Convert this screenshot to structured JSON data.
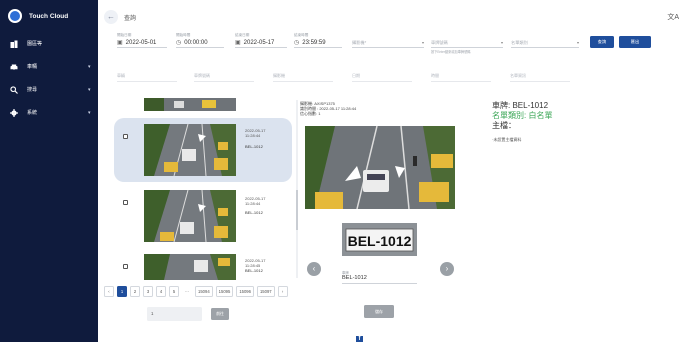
{
  "sidebar": {
    "brand": "Touch Cloud",
    "items": [
      {
        "icon": "building-icon",
        "label": "園區等",
        "has_caret": false
      },
      {
        "icon": "car-icon",
        "label": "車輛",
        "has_caret": true
      },
      {
        "icon": "search-icon",
        "label": "搜尋",
        "has_caret": true
      },
      {
        "icon": "gear-icon",
        "label": "系統",
        "has_caret": true
      }
    ]
  },
  "header": {
    "title": "查詢",
    "back_icon": "back-arrow-icon",
    "translate_icon": "translate-icon"
  },
  "filters": {
    "start_date": {
      "label": "開始日期",
      "value": "2022-05-01"
    },
    "start_time": {
      "label": "開始時間",
      "value": "00:00:00"
    },
    "end_date": {
      "label": "結束日期",
      "value": "2022-05-17"
    },
    "end_time": {
      "label": "結束時間",
      "value": "23:59:59"
    },
    "camera": {
      "placeholder": "攝影機*"
    },
    "plate": {
      "placeholder": "車牌號碼",
      "hint": "按下Enter鍵來增加車牌號碼"
    },
    "list_type": {
      "placeholder": "名單類別"
    },
    "search_button": "查詢",
    "export_button": "匯出"
  },
  "columns": [
    "車輛",
    "車牌號碼",
    "攝影機",
    "日期",
    "時間",
    "名單資訊"
  ],
  "results": [
    {
      "date": "2022-05-17",
      "time": "11:28:44",
      "plate": "BEL-1012"
    },
    {
      "date": "2022-05-17",
      "time": "11:28:44",
      "plate": "BEL-1012"
    },
    {
      "date": "2022-05-17",
      "time": "11:28:45",
      "plate": "BEL-1012"
    }
  ],
  "detail": {
    "camera_line": "攝影機: AXISP1375",
    "datetime_line": "識別時間 : 2022-05-17 11:28:44",
    "confidence_line": "信心指數: 1",
    "plate_field_label": "車牌",
    "plate_field_value": "BEL-1012",
    "plate_image_text": "BEL-1012",
    "save_button": "儲存",
    "info_plate": "車牌: BEL-1012",
    "info_list": "名單類別: 白名單",
    "info_owner": "主檔：",
    "info_note": "·未設置主檔資料"
  },
  "pagination": {
    "pages": [
      "1",
      "2",
      "3",
      "4",
      "5",
      "...",
      "15094",
      "15095",
      "15096",
      "15097"
    ],
    "active": "1",
    "goto_value": "1",
    "goto_button": "前往"
  },
  "colors": {
    "sidebar_bg": "#0f1b3d",
    "primary": "#1f4e9c",
    "list_green": "#3aa655",
    "selected_row": "#dbe3ef"
  }
}
